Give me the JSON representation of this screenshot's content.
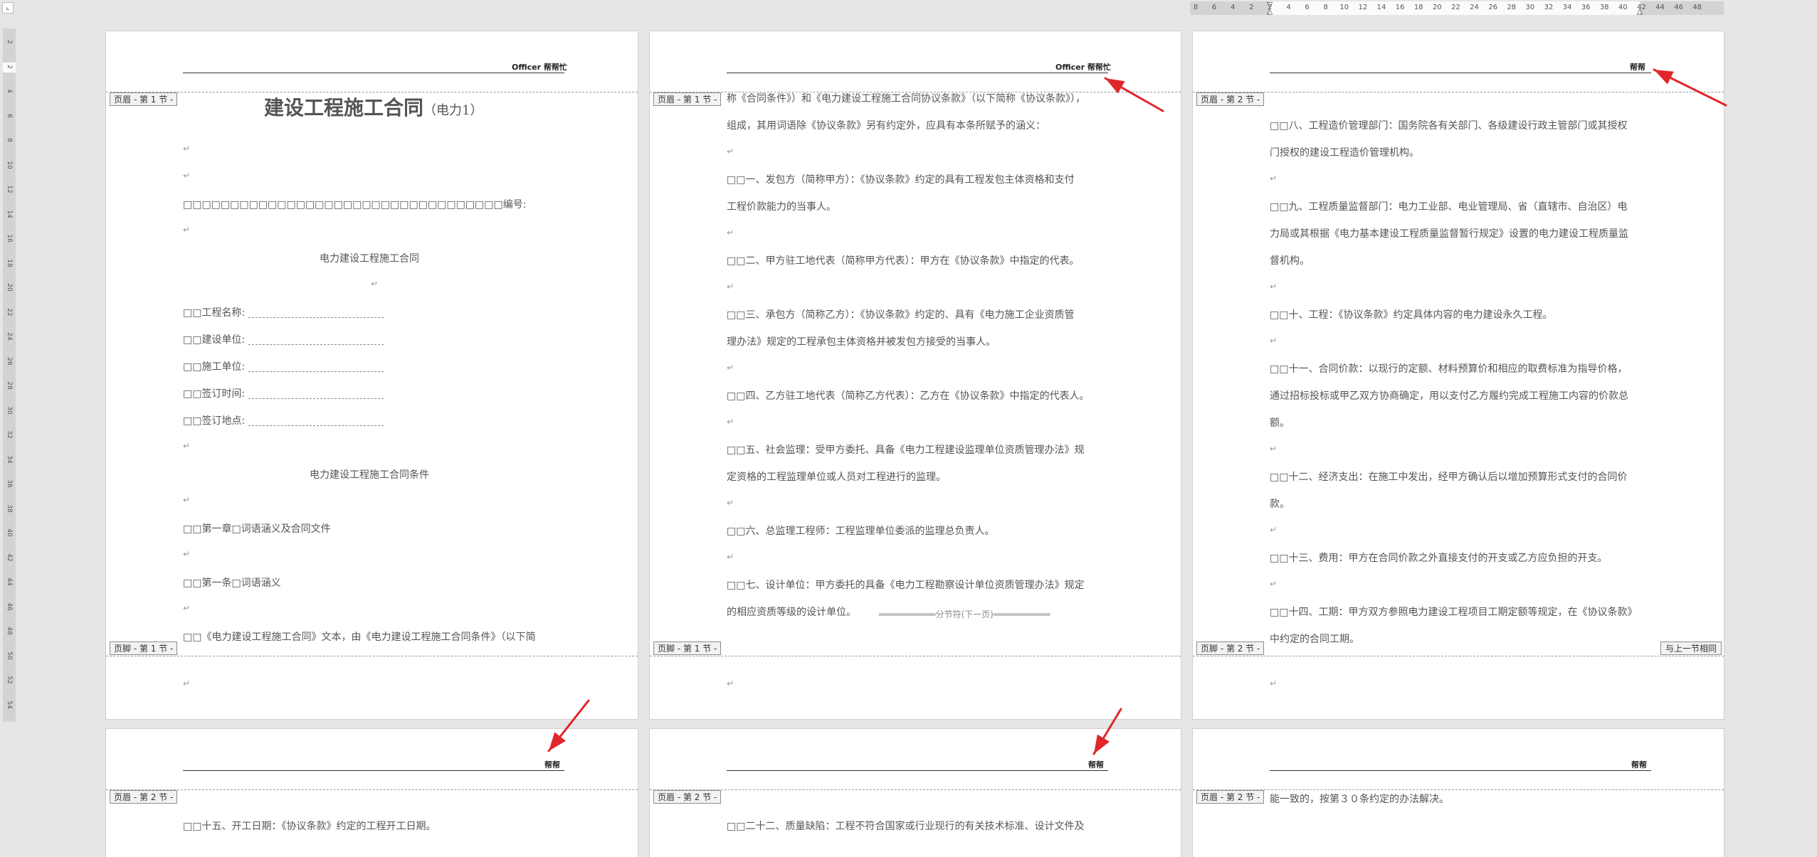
{
  "ruler": {
    "h_ticks": [
      "8",
      "6",
      "4",
      "2",
      "2",
      "4",
      "6",
      "8",
      "10",
      "12",
      "14",
      "16",
      "18",
      "20",
      "22",
      "24",
      "26",
      "28",
      "30",
      "32",
      "34",
      "36",
      "38",
      "40",
      "42",
      "44",
      "46",
      "48"
    ],
    "v_ticks": [
      "2",
      "2",
      "4",
      "6",
      "8",
      "10",
      "12",
      "14",
      "16",
      "18",
      "20",
      "22",
      "24",
      "26",
      "28",
      "30",
      "32",
      "34",
      "36",
      "38",
      "40",
      "42",
      "44",
      "46",
      "48",
      "50",
      "52",
      "54"
    ]
  },
  "labels": {
    "header_sec1": "页眉 - 第 1 节 -",
    "footer_sec1": "页脚 - 第 1 节 -",
    "header_sec2": "页眉 - 第 2 节 -",
    "footer_sec2": "页脚 - 第 2 节 -",
    "same_as_prev": "与上一节相同",
    "section_break": "分节符(下一页)"
  },
  "header_text": {
    "officer": "Officer 帮帮忙",
    "bangbang": "帮帮"
  },
  "page1": {
    "title": "建设工程施工合同",
    "subtitle": "（电力1）",
    "number_row": "□□□□□□□□□□□□□□□□□□□□□□□□□□□□□□□□□□编号:",
    "contract_name": "电力建设工程施工合同",
    "fields": [
      "□□工程名称: ",
      "□□建设单位: ",
      "□□施工单位: ",
      "□□签订时间: ",
      "□□签订地点: "
    ],
    "conditions_title": "电力建设工程施工合同条件",
    "chapter1": "□□第一章□词语涵义及合同文件",
    "article1": "□□第一条□词语涵义",
    "last_line": "□□《电力建设工程施工合同》文本，由《电力建设工程施工合同条件》（以下简"
  },
  "page2": {
    "lines": [
      "称《合同条件》）和《电力建设工程施工合同协议条款》（以下简称《协议条款》），",
      "组成，其用词语除《协议条款》另有约定外，应具有本条所赋予的涵义：",
      "□□一、发包方（简称甲方）：《协议条款》约定的具有工程发包主体资格和支付",
      "工程价款能力的当事人。",
      "□□二、甲方驻工地代表（简称甲方代表）：甲方在《协议条款》中指定的代表。",
      "□□三、承包方（简称乙方）：《协议条款》约定的、具有《电力施工企业资质管",
      "理办法》规定的工程承包主体资格并被发包方接受的当事人。",
      "□□四、乙方驻工地代表（简称乙方代表）：乙方在《协议条款》中指定的代表人。",
      "□□五、社会监理：受甲方委托、具备《电力工程建设监理单位资质管理办法》规",
      "定资格的工程监理单位或人员对工程进行的监理。",
      "□□六、总监理工程师：工程监理单位委派的监理总负责人。",
      "□□七、设计单位：甲方委托的具备《电力工程勘察设计单位资质管理办法》规定",
      "的相应资质等级的设计单位。"
    ]
  },
  "page3": {
    "lines": [
      "□□八、工程造价管理部门：国务院各有关部门、各级建设行政主管部门或其授权",
      "门授权的建设工程造价管理机构。",
      "□□九、工程质量监督部门：电力工业部、电业管理局、省（直辖市、自治区）电",
      "力局或其根据《电力基本建设工程质量监督暂行规定》设置的电力建设工程质量监",
      "督机构。",
      "□□十、工程：《协议条款》约定具体内容的电力建设永久工程。",
      "□□十一、合同价款：以现行的定额、材料预算价和相应的取费标准为指导价格，",
      "通过招标投标或甲乙双方协商确定，用以支付乙方履约完成工程施工内容的价款总",
      "额。",
      "□□十二、经济支出：在施工中发出，经甲方确认后以增加预算形式支付的合同价",
      "款。",
      "□□十三、费用：甲方在合同价款之外直接支付的开支或乙方应负担的开支。",
      "□□十四、工期：甲方双方参照电力建设工程项目工期定额等规定，在《协议条款》",
      "中约定的合同工期。"
    ]
  },
  "page4": {
    "line": "□□十五、开工日期：《协议条款》约定的工程开工日期。"
  },
  "page5": {
    "line": "□□二十二、质量缺陷：工程不符合国家或行业现行的有关技术标准、设计文件及"
  },
  "page6": {
    "line": "能一致的，按第３０条约定的办法解决。"
  },
  "colors": {
    "arrow": "#e0262b",
    "tag_bg": "#f2f2f2",
    "page_bg": "#ffffff",
    "canvas_bg": "#e6e6e6"
  }
}
